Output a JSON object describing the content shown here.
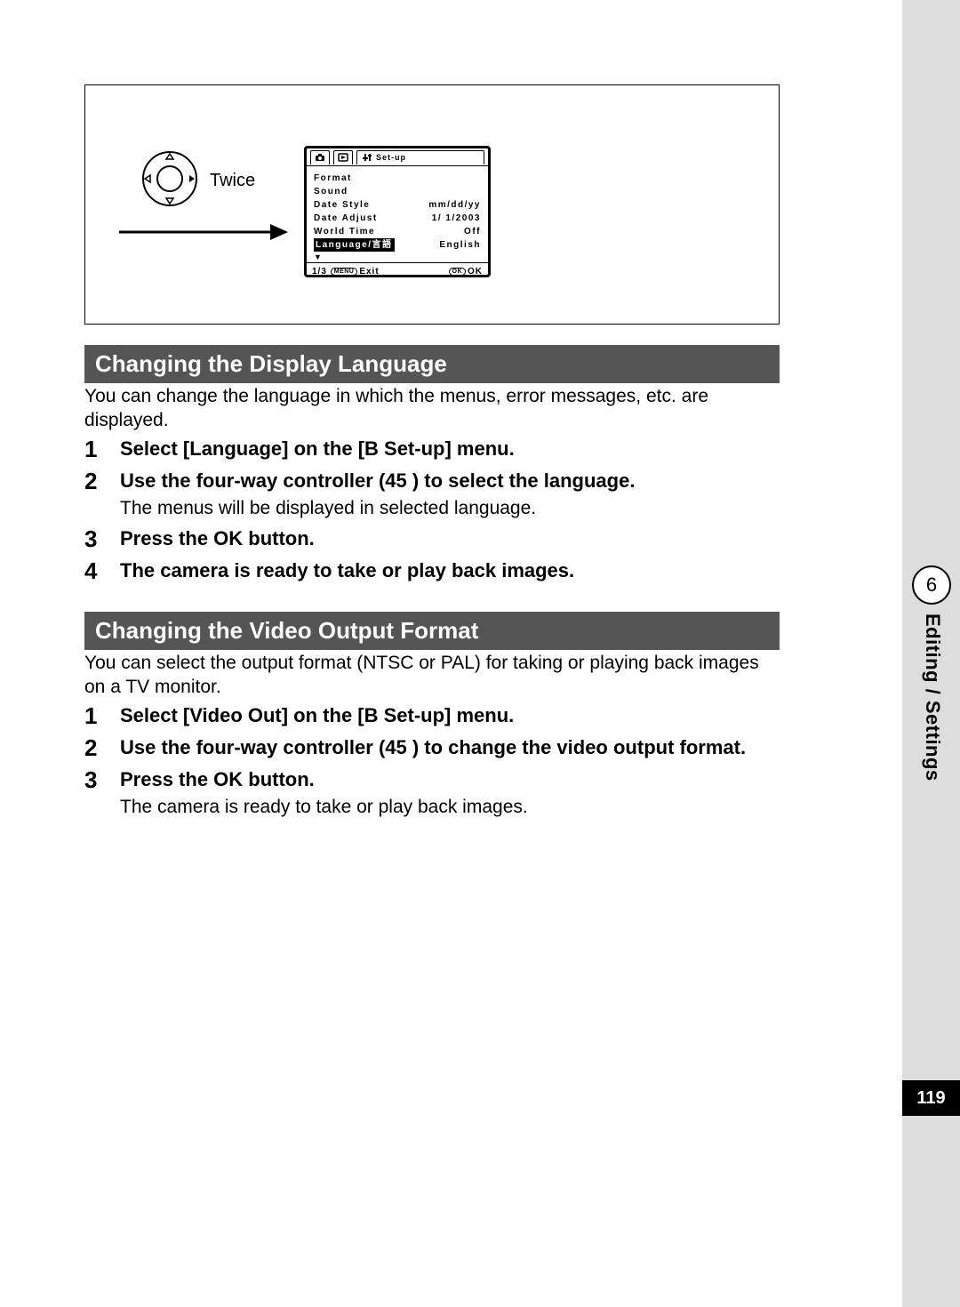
{
  "figure": {
    "twice_label": "Twice",
    "lcd": {
      "setup_tab_label": "Set-up",
      "rows": {
        "format": "Format",
        "sound": "Sound",
        "date_style_l": "Date Style",
        "date_style_r": "mm/dd/yy",
        "date_adjust_l": "Date Adjust",
        "date_adjust_r": "1/ 1/2003",
        "world_time_l": "World Time",
        "world_time_r": "Off",
        "language_l": "Language/言語",
        "language_r": "English"
      },
      "foot_left_page": "1/3",
      "foot_left_pill": "MENU",
      "foot_left_text": "Exit",
      "foot_right_pill": "OK",
      "foot_right_text": "OK"
    }
  },
  "section1": {
    "heading": "Changing the Display Language",
    "intro": "You can change the language in which the menus, error messages, etc. are displayed.",
    "steps": [
      {
        "num": "1",
        "title": "Select [Language] on the [B  Set-up] menu."
      },
      {
        "num": "2",
        "title": "Use the four-way controller (45   ) to select the language.",
        "note": "The menus will be displayed in selected language."
      },
      {
        "num": "3",
        "title": "Press the OK button."
      },
      {
        "num": "4",
        "title": "The camera is ready to take or play back images."
      }
    ]
  },
  "section2": {
    "heading": "Changing the Video Output Format",
    "intro": "You can select the output format (NTSC or PAL) for taking or playing back images on a TV monitor.",
    "steps": [
      {
        "num": "1",
        "title": "Select [Video Out] on the [B  Set-up] menu."
      },
      {
        "num": "2",
        "title": "Use the four-way controller (45   ) to change the video output format."
      },
      {
        "num": "3",
        "title": "Press the OK button.",
        "note": "The camera is ready to take or play back images."
      }
    ]
  },
  "side": {
    "chapter_num": "6",
    "chapter_title": "Editing / Settings",
    "page_num": "119"
  }
}
